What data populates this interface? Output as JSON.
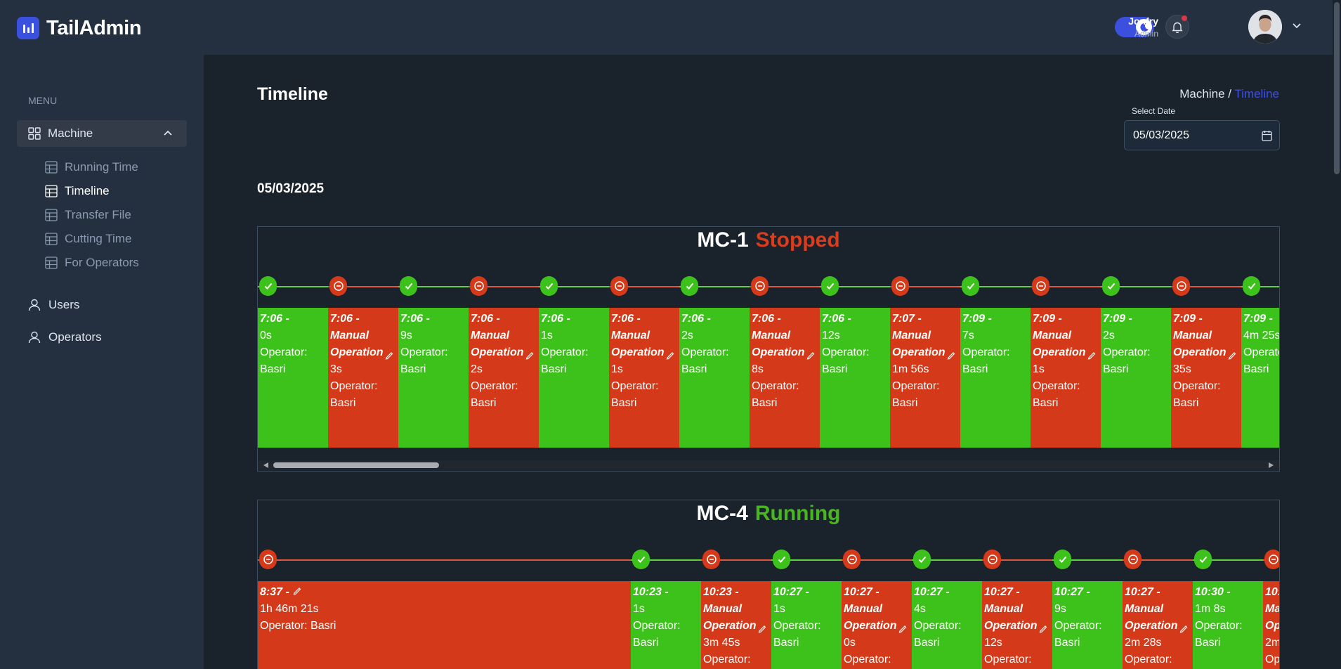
{
  "app": {
    "name": "TailAdmin"
  },
  "sidebar": {
    "menu_heading": "MENU",
    "machine_label": "Machine",
    "sub_items": [
      {
        "label": "Running Time"
      },
      {
        "label": "Timeline"
      },
      {
        "label": "Transfer File"
      },
      {
        "label": "Cutting Time"
      },
      {
        "label": "For Operators"
      }
    ],
    "items": [
      {
        "label": "Users"
      },
      {
        "label": "Operators"
      }
    ]
  },
  "header": {
    "user_name": "Jonfry",
    "user_role": "Admin"
  },
  "page": {
    "title": "Timeline",
    "breadcrumb_parent": "Machine /",
    "breadcrumb_current": "Timeline",
    "date_label": "Select Date",
    "date_value": "05/03/2025",
    "date_heading": "05/03/2025"
  },
  "colors": {
    "running": "#3dc21c",
    "stopped": "#d43a1a",
    "accent": "#3c50e0"
  },
  "machines": [
    {
      "name": "MC-1",
      "status": "Stopped",
      "events": [
        {
          "state": "running",
          "time": "7:06 -",
          "duration": "0s",
          "operator": "Operator:",
          "operator_name": "Basri"
        },
        {
          "state": "stopped",
          "time": "7:06 -",
          "label1": "Manual",
          "label2": "Operation",
          "duration": "3s",
          "operator": "Operator:",
          "operator_name": "Basri"
        },
        {
          "state": "running",
          "time": "7:06 -",
          "duration": "9s",
          "operator": "Operator:",
          "operator_name": "Basri"
        },
        {
          "state": "stopped",
          "time": "7:06 -",
          "label1": "Manual",
          "label2": "Operation",
          "duration": "2s",
          "operator": "Operator:",
          "operator_name": "Basri"
        },
        {
          "state": "running",
          "time": "7:06 -",
          "duration": "1s",
          "operator": "Operator:",
          "operator_name": "Basri"
        },
        {
          "state": "stopped",
          "time": "7:06 -",
          "label1": "Manual",
          "label2": "Operation",
          "duration": "1s",
          "operator": "Operator:",
          "operator_name": "Basri"
        },
        {
          "state": "running",
          "time": "7:06 -",
          "duration": "2s",
          "operator": "Operator:",
          "operator_name": "Basri"
        },
        {
          "state": "stopped",
          "time": "7:06 -",
          "label1": "Manual",
          "label2": "Operation",
          "duration": "8s",
          "operator": "Operator:",
          "operator_name": "Basri"
        },
        {
          "state": "running",
          "time": "7:06 -",
          "duration": "12s",
          "operator": "Operator:",
          "operator_name": "Basri"
        },
        {
          "state": "stopped",
          "time": "7:07 -",
          "label1": "Manual",
          "label2": "Operation",
          "duration": "1m 56s",
          "operator": "Operator:",
          "operator_name": "Basri"
        },
        {
          "state": "running",
          "time": "7:09 -",
          "duration": "7s",
          "operator": "Operator:",
          "operator_name": "Basri"
        },
        {
          "state": "stopped",
          "time": "7:09 -",
          "label1": "Manual",
          "label2": "Operation",
          "duration": "1s",
          "operator": "Operator:",
          "operator_name": "Basri"
        },
        {
          "state": "running",
          "time": "7:09 -",
          "duration": "2s",
          "operator": "Operator:",
          "operator_name": "Basri"
        },
        {
          "state": "stopped",
          "time": "7:09 -",
          "label1": "Manual",
          "label2": "Operation",
          "duration": "35s",
          "operator": "Operator:",
          "operator_name": "Basri"
        },
        {
          "state": "running",
          "time": "7:09 -",
          "duration": "4m 25s",
          "operator": "Operator:",
          "operator_name": "Basri"
        }
      ]
    },
    {
      "name": "MC-4",
      "status": "Running",
      "events": [
        {
          "state": "stopped",
          "time": "8:37 -",
          "duration": "1h 46m 21s",
          "operator": "Operator: Basri"
        },
        {
          "state": "running",
          "time": "10:23 -",
          "duration": "1s",
          "operator": "Operator:",
          "operator_name": "Basri"
        },
        {
          "state": "stopped",
          "time": "10:23 -",
          "label1": "Manual",
          "label2": "Operation",
          "duration": "3m 45s",
          "operator": "Operator:"
        },
        {
          "state": "running",
          "time": "10:27 -",
          "duration": "1s",
          "operator": "Operator:",
          "operator_name": "Basri"
        },
        {
          "state": "stopped",
          "time": "10:27 -",
          "label1": "Manual",
          "label2": "Operation",
          "duration": "0s",
          "operator": "Operator:"
        },
        {
          "state": "running",
          "time": "10:27 -",
          "duration": "4s",
          "operator": "Operator:",
          "operator_name": "Basri"
        },
        {
          "state": "stopped",
          "time": "10:27 -",
          "label1": "Manual",
          "label2": "Operation",
          "duration": "12s",
          "operator": "Operator:"
        },
        {
          "state": "running",
          "time": "10:27 -",
          "duration": "9s",
          "operator": "Operator:",
          "operator_name": "Basri"
        },
        {
          "state": "stopped",
          "time": "10:27 -",
          "label1": "Manual",
          "label2": "Operation",
          "duration": "2m 28s",
          "operator": "Operator:"
        },
        {
          "state": "running",
          "time": "10:30 -",
          "duration": "1m 8s",
          "operator": "Operator:",
          "operator_name": "Basri"
        },
        {
          "state": "stopped",
          "time": "10:",
          "label1": "Ma",
          "label2": "Op",
          "duration": "2m",
          "operator": "Op"
        }
      ]
    }
  ]
}
